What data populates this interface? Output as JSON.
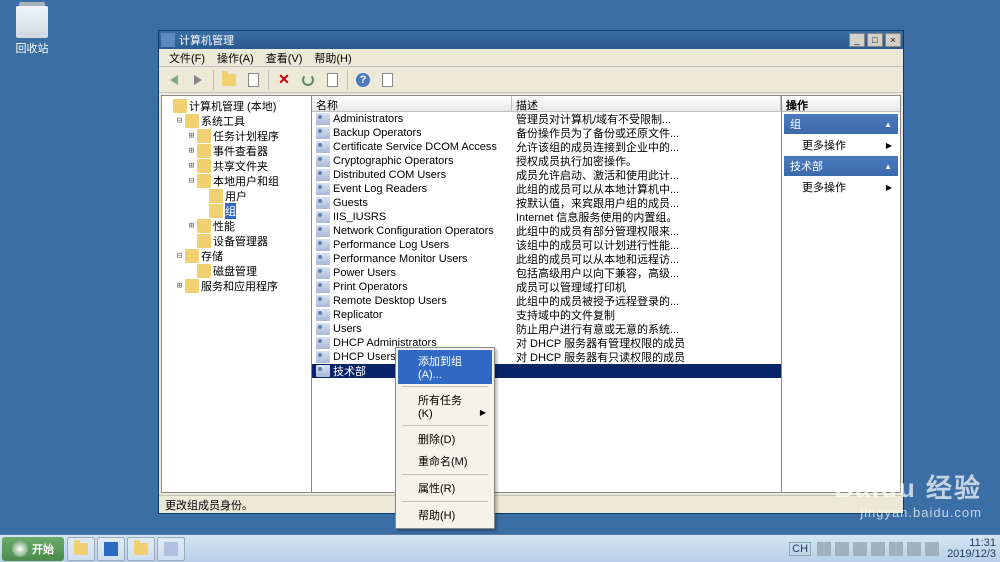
{
  "desktop": {
    "recycle_bin": "回收站"
  },
  "window": {
    "title": "计算机管理",
    "menu": {
      "file": "文件(F)",
      "action": "操作(A)",
      "view": "查看(V)",
      "help": "帮助(H)"
    },
    "statusbar": "更改组成员身份。"
  },
  "tree": [
    {
      "pm": "",
      "ind": 0,
      "label": "计算机管理 (本地)"
    },
    {
      "pm": "-",
      "ind": 1,
      "label": "系统工具"
    },
    {
      "pm": "+",
      "ind": 2,
      "label": "任务计划程序"
    },
    {
      "pm": "+",
      "ind": 2,
      "label": "事件查看器"
    },
    {
      "pm": "+",
      "ind": 2,
      "label": "共享文件夹"
    },
    {
      "pm": "-",
      "ind": 2,
      "label": "本地用户和组"
    },
    {
      "pm": "",
      "ind": 3,
      "label": "用户"
    },
    {
      "pm": "",
      "ind": 3,
      "label": "组",
      "sel": true
    },
    {
      "pm": "+",
      "ind": 2,
      "label": "性能"
    },
    {
      "pm": "",
      "ind": 2,
      "label": "设备管理器"
    },
    {
      "pm": "-",
      "ind": 1,
      "label": "存储"
    },
    {
      "pm": "",
      "ind": 2,
      "label": "磁盘管理"
    },
    {
      "pm": "+",
      "ind": 1,
      "label": "服务和应用程序"
    }
  ],
  "list": {
    "headers": {
      "name": "名称",
      "desc": "描述"
    },
    "rows": [
      {
        "name": "Administrators",
        "desc": "管理员对计算机/域有不受限制..."
      },
      {
        "name": "Backup Operators",
        "desc": "备份操作员为了备份或还原文件..."
      },
      {
        "name": "Certificate Service DCOM Access",
        "desc": "允许该组的成员连接到企业中的..."
      },
      {
        "name": "Cryptographic Operators",
        "desc": "授权成员执行加密操作。"
      },
      {
        "name": "Distributed COM Users",
        "desc": "成员允许启动、激活和使用此计..."
      },
      {
        "name": "Event Log Readers",
        "desc": "此组的成员可以从本地计算机中..."
      },
      {
        "name": "Guests",
        "desc": "按默认值，来宾跟用户组的成员..."
      },
      {
        "name": "IIS_IUSRS",
        "desc": "Internet 信息服务使用的内置组。"
      },
      {
        "name": "Network Configuration Operators",
        "desc": "此组中的成员有部分管理权限来..."
      },
      {
        "name": "Performance Log Users",
        "desc": "该组中的成员可以计划进行性能..."
      },
      {
        "name": "Performance Monitor Users",
        "desc": "此组的成员可以从本地和远程访..."
      },
      {
        "name": "Power Users",
        "desc": "包括高级用户以向下兼容，高级..."
      },
      {
        "name": "Print Operators",
        "desc": "成员可以管理域打印机"
      },
      {
        "name": "Remote Desktop Users",
        "desc": "此组中的成员被授予远程登录的..."
      },
      {
        "name": "Replicator",
        "desc": "支持域中的文件复制"
      },
      {
        "name": "Users",
        "desc": "防止用户进行有意或无意的系统..."
      },
      {
        "name": "DHCP Administrators",
        "desc": "对 DHCP 服务器有管理权限的成员"
      },
      {
        "name": "DHCP Users",
        "desc": "对 DHCP 服务器有只读权限的成员"
      },
      {
        "name": "技术部",
        "desc": "",
        "sel": true
      }
    ]
  },
  "actions": {
    "header": "操作",
    "group_hdr": "组",
    "more": "更多操作",
    "sel_hdr": "技术部"
  },
  "context": {
    "add": "添加到组(A)...",
    "all_tasks": "所有任务(K)",
    "delete": "删除(D)",
    "rename": "重命名(M)",
    "properties": "属性(R)",
    "help": "帮助(H)"
  },
  "taskbar": {
    "start": "开始",
    "lang": "CH",
    "time": "11:31",
    "date": "2019/12/3"
  },
  "watermark": {
    "big": "Baidu 经验",
    "small": "jingyan.baidu.com"
  }
}
